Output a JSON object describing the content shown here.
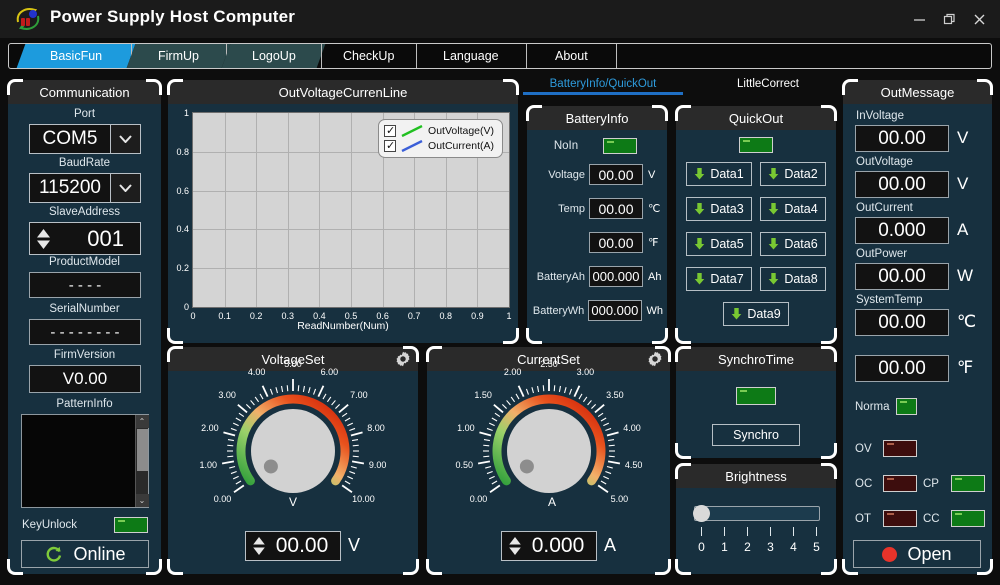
{
  "window": {
    "title": "Power Supply Host Computer",
    "logo_icon": "app-logo-icon",
    "minimize": "minimize-icon",
    "maximize": "maximize-icon",
    "close": "close-icon"
  },
  "main_tabs": [
    {
      "label": "BasicFun",
      "active": true
    },
    {
      "label": "FirmUp",
      "active": false
    },
    {
      "label": "LogoUp",
      "active": false
    },
    {
      "label": "CheckUp",
      "active": false
    },
    {
      "label": "Language",
      "active": false
    },
    {
      "label": "About",
      "active": false
    }
  ],
  "communication": {
    "title": "Communication",
    "port_label": "Port",
    "port_value": "COM5",
    "baud_label": "BaudRate",
    "baud_value": "115200",
    "slave_label": "SlaveAddress",
    "slave_value": "001",
    "product_label": "ProductModel",
    "product_value": "- - - -",
    "serial_label": "SerialNumber",
    "serial_value": "- - - - - - - -",
    "firm_label": "FirmVersion",
    "firm_value": "V0.00",
    "pattern_label": "PatternInfo",
    "pattern_value": "",
    "keyunlock_label": "KeyUnlock",
    "keyunlock_state": "green",
    "online_label": "Online",
    "online_icon": "refresh-icon"
  },
  "chart_data": {
    "type": "line",
    "title": "OutVoltageCurrenLine",
    "xlabel": "ReadNumber(Num)",
    "ylabel": "",
    "xlim": [
      0,
      1
    ],
    "ylim": [
      0,
      1
    ],
    "xticks": [
      "0",
      "0.1",
      "0.2",
      "0.3",
      "0.4",
      "0.5",
      "0.6",
      "0.7",
      "0.8",
      "0.9",
      "1"
    ],
    "yticks": [
      "0",
      "0.2",
      "0.4",
      "0.6",
      "0.8",
      "1"
    ],
    "grid": true,
    "legend_position": "top-right",
    "series": [
      {
        "name": "OutVoltage(V)",
        "color": "#21c021",
        "checked": true,
        "values": []
      },
      {
        "name": "OutCurrent(A)",
        "color": "#3b5fd8",
        "checked": true,
        "values": []
      }
    ]
  },
  "sub_tabs": [
    {
      "label": "BatteryInfo/QuickOut",
      "active": true
    },
    {
      "label": "LittleCorrect",
      "active": false
    }
  ],
  "battery_info": {
    "title": "BatteryInfo",
    "noin_label": "NoIn",
    "noin_state": "green",
    "rows": [
      {
        "label": "Voltage",
        "value": "00.00",
        "unit": "V"
      },
      {
        "label": "Temp",
        "value": "00.00",
        "unit": "℃"
      },
      {
        "label": "",
        "value": "00.00",
        "unit": "℉"
      },
      {
        "label": "BatteryAh",
        "value": "000.000",
        "unit": "Ah"
      },
      {
        "label": "BatteryWh",
        "value": "000.000",
        "unit": "Wh"
      }
    ]
  },
  "quick_out": {
    "title": "QuickOut",
    "status_state": "green",
    "buttons": [
      "Data1",
      "Data2",
      "Data3",
      "Data4",
      "Data5",
      "Data6",
      "Data7",
      "Data8",
      "Data9"
    ],
    "button_icon": "download-arrow-icon"
  },
  "voltage_set": {
    "title": "VoltageSet",
    "gear_icon": "gear-icon",
    "unit_center": "V",
    "value": "00.00",
    "unit": "V",
    "ticks": [
      "0.00",
      "1.00",
      "2.00",
      "3.00",
      "4.00",
      "5.00",
      "6.00",
      "7.00",
      "8.00",
      "9.00",
      "10.00"
    ],
    "min": 0,
    "max": 10,
    "current": 0
  },
  "current_set": {
    "title": "CurrentSet",
    "gear_icon": "gear-icon",
    "unit_center": "A",
    "value": "0.000",
    "unit": "A",
    "ticks": [
      "0.00",
      "0.50",
      "1.00",
      "1.50",
      "2.00",
      "2.50",
      "3.00",
      "3.50",
      "4.00",
      "4.50",
      "5.00"
    ],
    "min": 0,
    "max": 5,
    "current": 0
  },
  "synchro_time": {
    "title": "SynchroTime",
    "status_state": "green",
    "button_label": "Synchro"
  },
  "brightness": {
    "title": "Brightness",
    "value": 0,
    "ticks": [
      "0",
      "1",
      "2",
      "3",
      "4",
      "5"
    ]
  },
  "out_message": {
    "title": "OutMessage",
    "rows": [
      {
        "label": "InVoltage",
        "value": "00.00",
        "unit": "V"
      },
      {
        "label": "OutVoltage",
        "value": "00.00",
        "unit": "V"
      },
      {
        "label": "OutCurrent",
        "value": "0.000",
        "unit": "A"
      },
      {
        "label": "OutPower",
        "value": "00.00",
        "unit": "W"
      },
      {
        "label": "SystemTemp",
        "value": "00.00",
        "unit": "℃"
      },
      {
        "label": "",
        "value": "00.00",
        "unit": "℉"
      }
    ],
    "indicators": [
      {
        "label": "Norma",
        "state": "green"
      },
      {
        "label": "OV",
        "state": "red"
      },
      {
        "label": "OC",
        "state": "red"
      },
      {
        "label": "CP",
        "state": "green"
      },
      {
        "label": "OT",
        "state": "red"
      },
      {
        "label": "CC",
        "state": "green"
      }
    ],
    "open_label": "Open",
    "open_state": "red"
  },
  "colors": {
    "accent_blue": "#1d9bdd",
    "panel_bg": "#17303f",
    "led_green": "#0d7a16",
    "led_red": "#3d0d0d",
    "knob_green": "#3aa53a",
    "knob_red": "#d8300c"
  }
}
